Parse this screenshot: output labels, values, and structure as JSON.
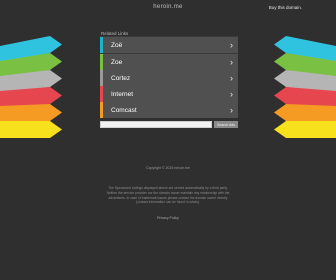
{
  "header": {
    "site_name": "heroin.me",
    "buy_domain_label": "Buy this domain."
  },
  "related": {
    "title": "Related Links",
    "items": [
      {
        "label": "Zoë",
        "accent": "#1db3c9"
      },
      {
        "label": "Zoe",
        "accent": "#7ac143"
      },
      {
        "label": "Cortez",
        "accent": "#9a9a9a"
      },
      {
        "label": "Internet",
        "accent": "#e6474f"
      },
      {
        "label": "Comcast",
        "accent": "#f59a23"
      }
    ]
  },
  "arrow_colors": [
    "#2fc3e0",
    "#7ac143",
    "#b5b5b5",
    "#e6474f",
    "#f59a23",
    "#f7e01c"
  ],
  "search": {
    "placeholder": "",
    "button_label": "Search Ads"
  },
  "footer": {
    "copyright": "Copyright © 2024 heroin.me",
    "disclaimer": "The Sponsored Listings displayed above are served automatically by a third party. Neither the service provider nor the domain owner maintain any relationship with the advertisers. In case of trademark issues please contact the domain owner directly (contact information can be found in whois).",
    "privacy_label": "Privacy Policy"
  }
}
